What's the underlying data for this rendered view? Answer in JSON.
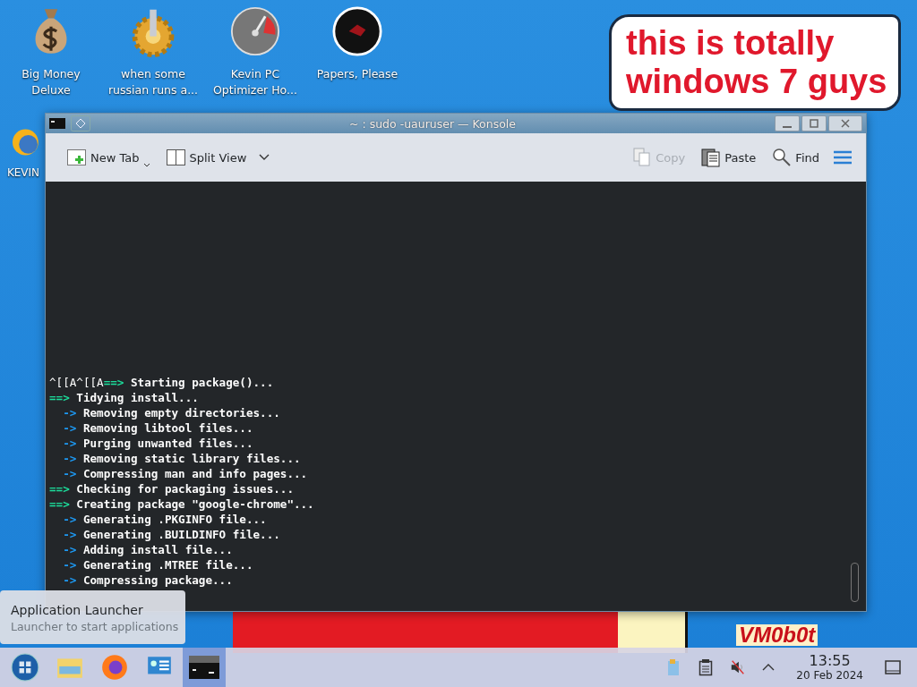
{
  "desktop_icons": [
    {
      "kind": "money",
      "lines": [
        "Big Money",
        "Deluxe"
      ]
    },
    {
      "kind": "gear",
      "lines": [
        "when some",
        "russian runs a..."
      ]
    },
    {
      "kind": "gauge",
      "lines": [
        "Kevin PC",
        "Optimizer Ho..."
      ]
    },
    {
      "kind": "disc",
      "lines": [
        "Papers, Please"
      ]
    }
  ],
  "side_icon": {
    "label": "KEVIN"
  },
  "wallpaper_text": "VM0b0t",
  "window": {
    "title": "~ : sudo -uauruser — Konsole",
    "toolbar_left": [
      {
        "kind": "new-tab",
        "label": "New Tab",
        "disabled": false
      },
      {
        "kind": "split",
        "label": "Split View",
        "disabled": false
      }
    ],
    "toolbar_right": [
      {
        "kind": "copy",
        "label": "Copy",
        "disabled": true
      },
      {
        "kind": "paste",
        "label": "Paste",
        "disabled": false
      },
      {
        "kind": "find",
        "label": "Find",
        "disabled": false
      }
    ],
    "terminal_lines": [
      {
        "kind": "step",
        "pre": "^[[A^[[A",
        "arrow": "==>",
        "text": "Starting package()..."
      },
      {
        "kind": "step",
        "arrow": "==>",
        "text": "Tidying install..."
      },
      {
        "kind": "sub",
        "arrow": "->",
        "text": "Removing empty directories..."
      },
      {
        "kind": "sub",
        "arrow": "->",
        "text": "Removing libtool files..."
      },
      {
        "kind": "sub",
        "arrow": "->",
        "text": "Purging unwanted files..."
      },
      {
        "kind": "sub",
        "arrow": "->",
        "text": "Removing static library files..."
      },
      {
        "kind": "sub",
        "arrow": "->",
        "text": "Compressing man and info pages..."
      },
      {
        "kind": "step",
        "arrow": "==>",
        "text": "Checking for packaging issues..."
      },
      {
        "kind": "step",
        "arrow": "==>",
        "text": "Creating package \"google-chrome\"..."
      },
      {
        "kind": "sub",
        "arrow": "->",
        "text": "Generating .PKGINFO file..."
      },
      {
        "kind": "sub",
        "arrow": "->",
        "text": "Generating .BUILDINFO file..."
      },
      {
        "kind": "sub",
        "arrow": "->",
        "text": "Adding install file..."
      },
      {
        "kind": "sub",
        "arrow": "->",
        "text": "Generating .MTREE file..."
      },
      {
        "kind": "sub",
        "arrow": "->",
        "text": "Compressing package..."
      }
    ]
  },
  "tooltip": {
    "title": "Application Launcher",
    "subtitle": "Launcher to start applications"
  },
  "annotation": {
    "lines": [
      "this is totally",
      "windows 7 guys"
    ]
  },
  "taskbar": {
    "apps": [
      {
        "kind": "start",
        "selected": false
      },
      {
        "kind": "files",
        "selected": false
      },
      {
        "kind": "browser",
        "selected": false
      },
      {
        "kind": "settings",
        "selected": false
      },
      {
        "kind": "terminal",
        "selected": true
      }
    ],
    "clock": {
      "time": "13:55",
      "date": "20 Feb 2024"
    }
  }
}
